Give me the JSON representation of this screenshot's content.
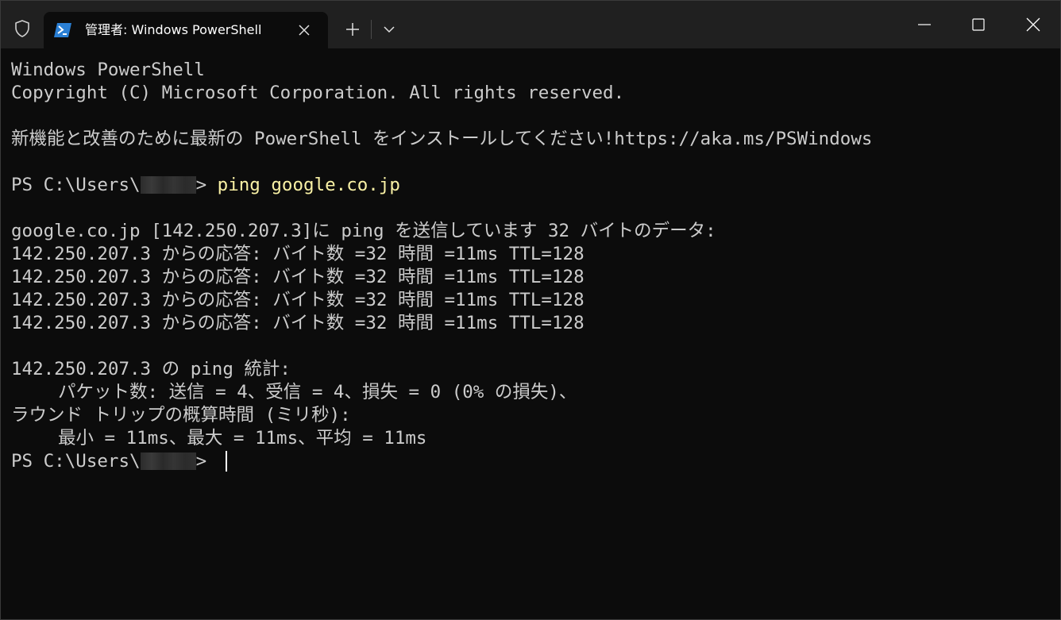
{
  "titlebar": {
    "tab_title": "管理者: Windows PowerShell",
    "icons": {
      "shield": "shield-icon",
      "tab": "powershell-icon",
      "close_tab": "close-icon",
      "new_tab": "plus-icon",
      "dropdown": "chevron-down-icon",
      "minimize": "minimize-icon",
      "maximize": "maximize-icon",
      "close_window": "close-icon"
    }
  },
  "terminal": {
    "lines": {
      "l1": "Windows PowerShell",
      "l2": "Copyright (C) Microsoft Corporation. All rights reserved.",
      "l3": "新機能と改善のために最新の PowerShell をインストールしてください!https://aka.ms/PSWindows",
      "prompt_prefix": "PS C:\\Users\\",
      "prompt_suffix": "> ",
      "command": "ping google.co.jp",
      "l5": "google.co.jp [142.250.207.3]に ping を送信しています 32 バイトのデータ:",
      "reply1": "142.250.207.3 からの応答: バイト数 =32 時間 =11ms TTL=128",
      "reply2": "142.250.207.3 からの応答: バイト数 =32 時間 =11ms TTL=128",
      "reply3": "142.250.207.3 からの応答: バイト数 =32 時間 =11ms TTL=128",
      "reply4": "142.250.207.3 からの応答: バイト数 =32 時間 =11ms TTL=128",
      "stats_header": "142.250.207.3 の ping 統計:",
      "packets": "パケット数: 送信 = 4、受信 = 4、損失 = 0 (0% の損失)、",
      "rtt_header": "ラウンド トリップの概算時間 (ミリ秒):",
      "rtt_values": "最小 = 11ms、最大 = 11ms、平均 = 11ms"
    }
  },
  "colors": {
    "background": "#0c0c0c",
    "titlebar": "#202020",
    "text": "#cccccc",
    "command": "#f9f1a5"
  }
}
